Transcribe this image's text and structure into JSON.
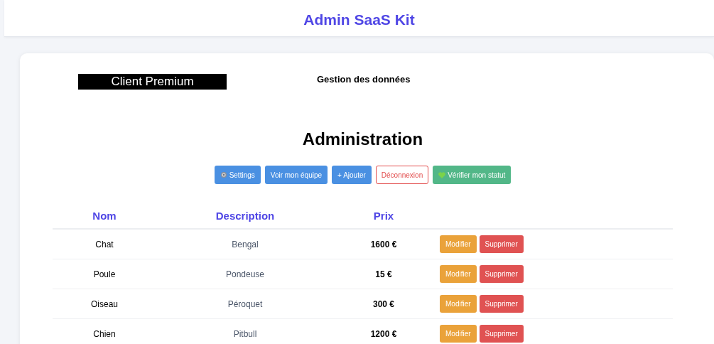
{
  "header": {
    "title": "Admin SaaS Kit"
  },
  "badge": "Client Premium",
  "subtitle": "Gestion des données",
  "heading": "Administration",
  "actions": [
    {
      "label": "Settings",
      "kind": "settings"
    },
    {
      "label": "Voir mon équipe",
      "kind": "primary"
    },
    {
      "label": "+ Ajouter",
      "kind": "primary"
    },
    {
      "label": "Déconnexion",
      "kind": "outline"
    },
    {
      "label": "Vérifier mon statut",
      "kind": "status"
    }
  ],
  "table": {
    "columns": [
      "Nom",
      "Description",
      "Prix"
    ],
    "rows": [
      {
        "name": "Chat",
        "description": "Bengal",
        "price": "1600 €",
        "buttons": [
          "Modifier",
          "Supprimer"
        ]
      },
      {
        "name": "Poule",
        "description": "Pondeuse",
        "price": "15 €",
        "buttons": [
          "Modifier",
          "Supprimer"
        ]
      },
      {
        "name": "Oiseau",
        "description": "Péroquet",
        "price": "300 €",
        "buttons": [
          "Modifier",
          "Supprimer"
        ]
      },
      {
        "name": "Chien",
        "description": "Pitbull",
        "price": "1200 €",
        "buttons": [
          "Modifier",
          "Supprimer"
        ]
      }
    ]
  }
}
